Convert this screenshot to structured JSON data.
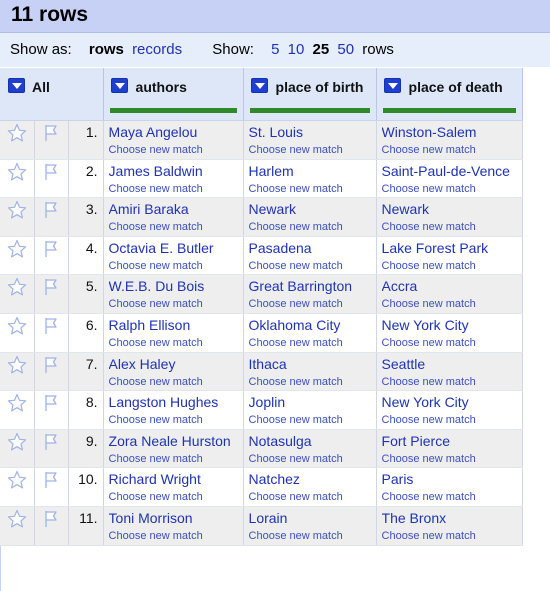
{
  "header": {
    "title": "11 rows"
  },
  "controls": {
    "show_as_label": "Show as:",
    "rows_label": "rows",
    "records_label": "records",
    "show_label": "Show:",
    "page_sizes": [
      "5",
      "10",
      "25",
      "50"
    ],
    "selected_page_size": "25",
    "rows_suffix": "rows"
  },
  "columns": {
    "all": "All",
    "authors": "authors",
    "place_of_birth": "place of birth",
    "place_of_death": "place of death"
  },
  "match_label": "Choose new match",
  "rows": [
    {
      "num": "1.",
      "author": "Maya Angelou",
      "birth": "St. Louis",
      "death": "Winston-Salem"
    },
    {
      "num": "2.",
      "author": "James Baldwin",
      "birth": "Harlem",
      "death": "Saint-Paul-de-Vence"
    },
    {
      "num": "3.",
      "author": "Amiri Baraka",
      "birth": "Newark",
      "death": "Newark"
    },
    {
      "num": "4.",
      "author": "Octavia E. Butler",
      "birth": "Pasadena",
      "death": "Lake Forest Park"
    },
    {
      "num": "5.",
      "author": "W.E.B. Du Bois",
      "birth": "Great Barrington",
      "death": "Accra"
    },
    {
      "num": "6.",
      "author": "Ralph Ellison",
      "birth": "Oklahoma City",
      "death": "New York City"
    },
    {
      "num": "7.",
      "author": "Alex Haley",
      "birth": "Ithaca",
      "death": "Seattle"
    },
    {
      "num": "8.",
      "author": "Langston Hughes",
      "birth": "Joplin",
      "death": "New York City"
    },
    {
      "num": "9.",
      "author": "Zora Neale Hurston",
      "birth": "Notasulga",
      "death": "Fort Pierce"
    },
    {
      "num": "10.",
      "author": "Richard Wright",
      "birth": "Natchez",
      "death": "Paris"
    },
    {
      "num": "11.",
      "author": "Toni Morrison",
      "birth": "Lorain",
      "death": "The Bronx"
    }
  ],
  "icons": {
    "star": "star-icon",
    "flag": "flag-icon",
    "dropdown": "dropdown-arrow-icon"
  },
  "colors": {
    "header_bg": "#c7d1f6",
    "controls_bg": "#e6eefb",
    "link": "#1e32b4",
    "match_bar": "#2f8a2a",
    "dropdown": "#1e3fcf"
  }
}
